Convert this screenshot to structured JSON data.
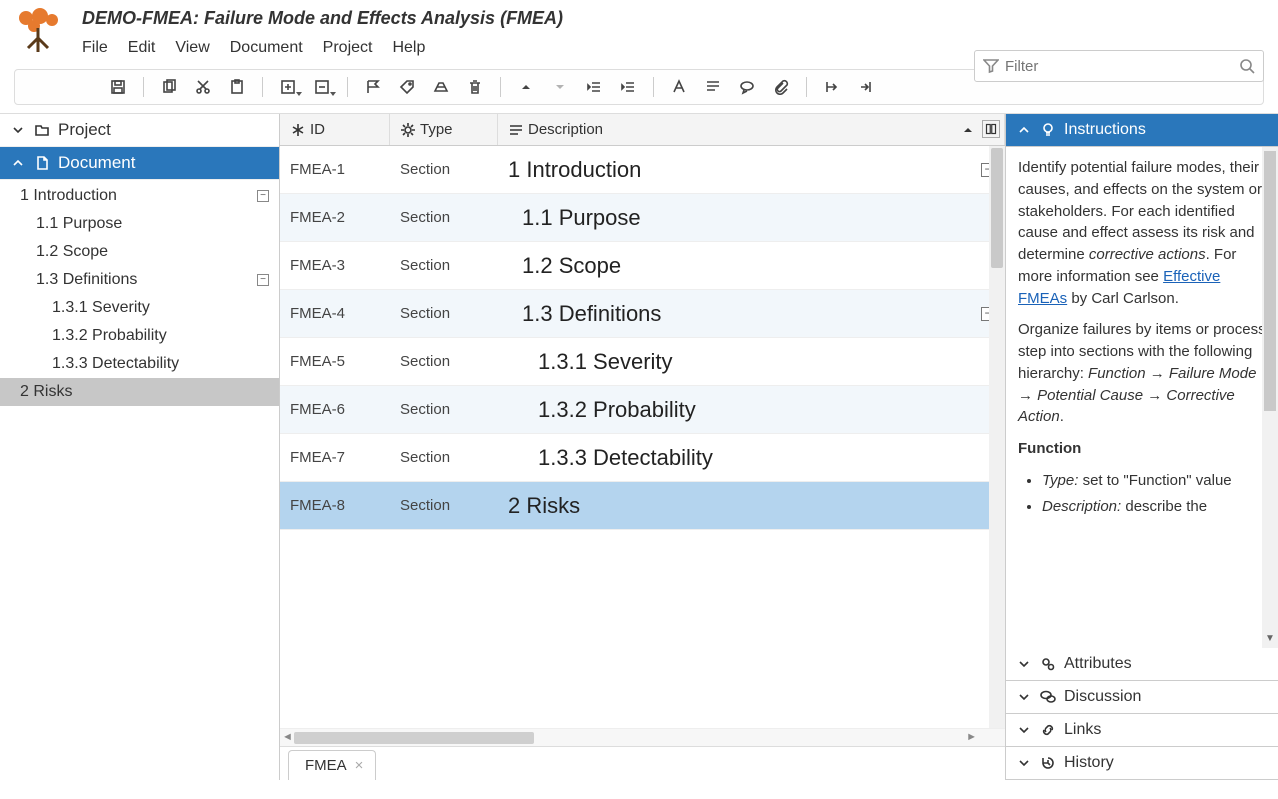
{
  "app": {
    "title": "DEMO-FMEA: Failure Mode and Effects Analysis (FMEA)"
  },
  "menubar": [
    "File",
    "Edit",
    "View",
    "Document",
    "Project",
    "Help"
  ],
  "filter": {
    "placeholder": "Filter"
  },
  "sidebar": {
    "project_label": "Project",
    "document_label": "Document",
    "tree": [
      {
        "label": "1 Introduction",
        "indent": 1,
        "expander": "⊟"
      },
      {
        "label": "1.1 Purpose",
        "indent": 2
      },
      {
        "label": "1.2 Scope",
        "indent": 2
      },
      {
        "label": "1.3 Definitions",
        "indent": 2,
        "expander": "⊟"
      },
      {
        "label": "1.3.1 Severity",
        "indent": 3
      },
      {
        "label": "1.3.2 Probability",
        "indent": 3
      },
      {
        "label": "1.3.3 Detectability",
        "indent": 3
      },
      {
        "label": "2 Risks",
        "indent": 1,
        "selected": true
      }
    ]
  },
  "grid": {
    "columns": {
      "id": "ID",
      "type": "Type",
      "desc": "Description"
    },
    "rows": [
      {
        "id": "FMEA-1",
        "type": "Section",
        "desc": "1 Introduction",
        "level": "h1",
        "alt": false,
        "expander": "−"
      },
      {
        "id": "FMEA-2",
        "type": "Section",
        "desc": "1.1 Purpose",
        "level": "h2",
        "alt": true
      },
      {
        "id": "FMEA-3",
        "type": "Section",
        "desc": "1.2 Scope",
        "level": "h2",
        "alt": false
      },
      {
        "id": "FMEA-4",
        "type": "Section",
        "desc": "1.3 Definitions",
        "level": "h2",
        "alt": true,
        "expander": "−"
      },
      {
        "id": "FMEA-5",
        "type": "Section",
        "desc": "1.3.1 Severity",
        "level": "h3",
        "alt": false
      },
      {
        "id": "FMEA-6",
        "type": "Section",
        "desc": "1.3.2 Probability",
        "level": "h3",
        "alt": true
      },
      {
        "id": "FMEA-7",
        "type": "Section",
        "desc": "1.3.3 Detectability",
        "level": "h3",
        "alt": false
      },
      {
        "id": "FMEA-8",
        "type": "Section",
        "desc": "2 Risks",
        "level": "h1",
        "selected": true
      }
    ]
  },
  "tab": {
    "label": "FMEA"
  },
  "right": {
    "instructions_label": "Instructions",
    "attributes_label": "Attributes",
    "discussion_label": "Discussion",
    "links_label": "Links",
    "history_label": "History",
    "body": {
      "p1a": "Identify potential failure modes, their causes, and effects on the system or stakeholders. For each identified cause and effect assess its risk and determine ",
      "p1em": "corrective actions",
      "p1b": ". For more information see ",
      "link": "Effective FMEAs",
      "p1c": " by Carl Carlson.",
      "p2a": "Organize failures by items or process step into sections with the following hierarchy: ",
      "p2em": "Function → Failure Mode → Potential Cause → Corrective Action",
      "p2b": ".",
      "func_hdr": "Function",
      "li1em": "Type:",
      "li1": " set to \"Function\" value",
      "li2em": "Description:",
      "li2": " describe the"
    }
  }
}
